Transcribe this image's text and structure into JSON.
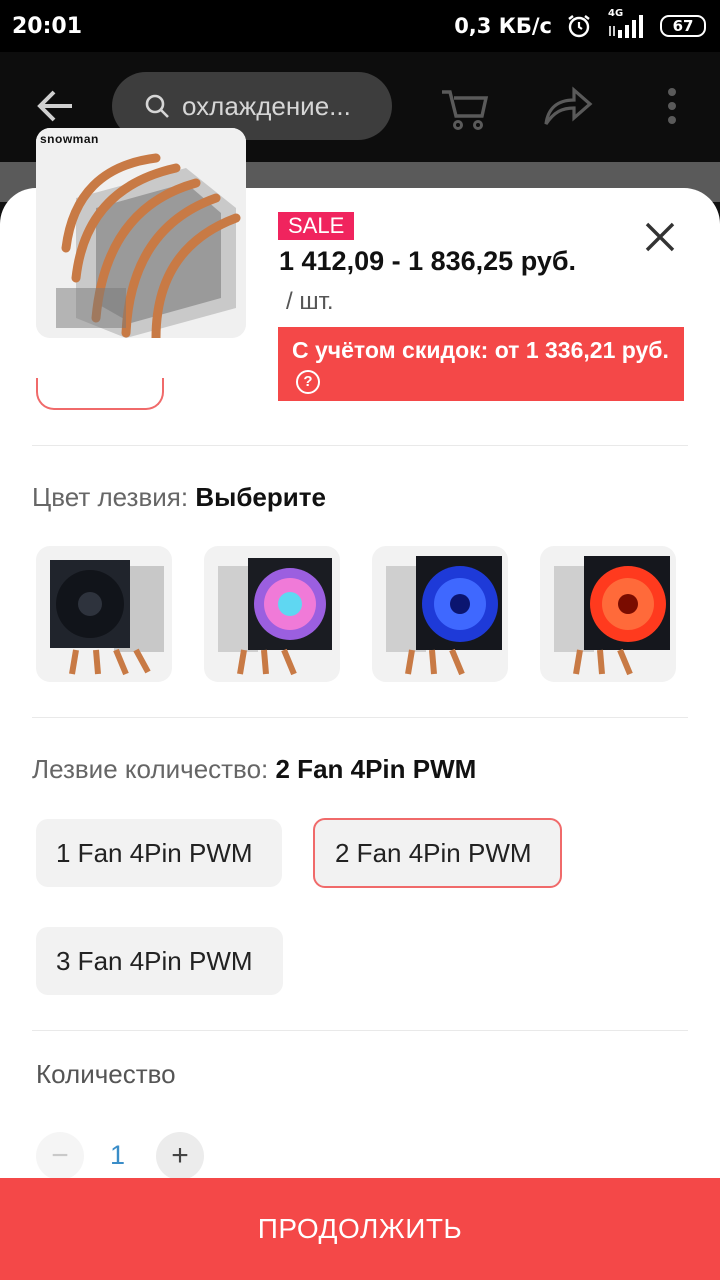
{
  "status_bar": {
    "time": "20:01",
    "speed": "0,3 КБ/с",
    "network": "4G",
    "battery": "67"
  },
  "header": {
    "search_text": "охлаждение..."
  },
  "product": {
    "brand": "snowman",
    "sale_badge": "SALE",
    "price_range": "1 412,09 - 1 836,25 руб.",
    "unit": "/ шт.",
    "discount_text": "С учётом скидок: от 1 336,21 руб."
  },
  "color_section": {
    "label": "Цвет лезвия:",
    "value": "Выберите",
    "swatches": [
      {
        "name": "black-fan",
        "color": "#2a2f38"
      },
      {
        "name": "rgb-fan",
        "color": "#d46bd6"
      },
      {
        "name": "blue-fan",
        "color": "#2c4fe8"
      },
      {
        "name": "red-fan",
        "color": "#ff3a26"
      }
    ]
  },
  "fan_section": {
    "label": "Лезвие количество:",
    "value": "2 Fan 4Pin PWM",
    "options": [
      "1 Fan 4Pin PWM",
      "2 Fan 4Pin PWM",
      "3 Fan 4Pin PWM"
    ],
    "selected_index": 1
  },
  "quantity": {
    "label": "Количество",
    "value": "1",
    "minus": "−",
    "plus": "+"
  },
  "continue_button": "ПРОДОЛЖИТЬ",
  "colors": {
    "accent": "#f44848",
    "sale": "#f0245e",
    "qty": "#3a8dc8"
  }
}
